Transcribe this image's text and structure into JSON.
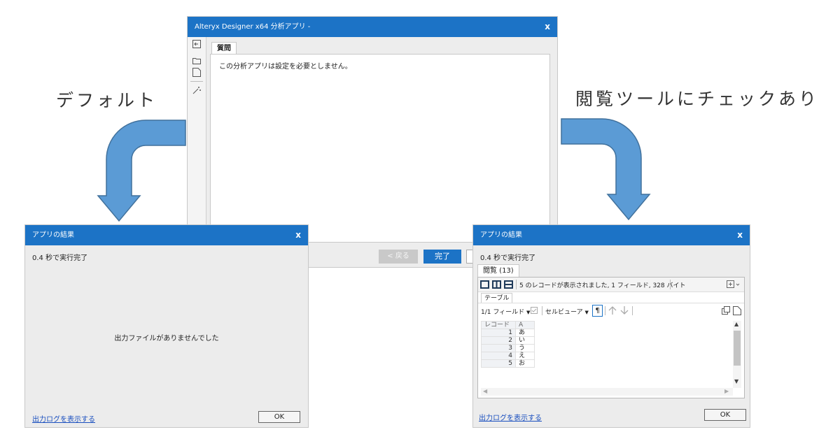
{
  "labels": {
    "left": "デフォルト",
    "right": "閲覧ツールにチェックあり"
  },
  "main_window": {
    "title": "Alteryx Designer x64 分析アプリ -",
    "close": "x",
    "tab": "質問",
    "message": "この分析アプリは設定を必要としません。",
    "back_button": "< 戻る",
    "finish_button": "完了"
  },
  "left_dialog": {
    "title": "アプリの結果",
    "close": "x",
    "status": "0.4 秒で実行完了",
    "empty_message": "出力ファイルがありませんでした",
    "log_link": "出力ログを表示する",
    "ok": "OK"
  },
  "right_dialog": {
    "title": "アプリの結果",
    "close": "x",
    "status": "0.4 秒で実行完了",
    "tab": "閲覧 (13)",
    "record_info": "5 のレコードが表示されました, 1 フィールド, 328 バイト",
    "subtab": "テーブル",
    "field_selector": "1/1 フィールド",
    "cell_viewer": "セルビューア",
    "pilcrow": "¶",
    "columns": [
      "レコード",
      "A"
    ],
    "rows": [
      {
        "n": "1",
        "a": "あ"
      },
      {
        "n": "2",
        "a": "い"
      },
      {
        "n": "3",
        "a": "う"
      },
      {
        "n": "4",
        "a": "え"
      },
      {
        "n": "5",
        "a": "お"
      }
    ],
    "log_link": "出力ログを表示する",
    "ok": "OK"
  },
  "colors": {
    "titlebar": "#1c73c6",
    "arrow": "#5b9bd5",
    "arrow_border": "#41719c",
    "primary_button": "#1c73c6"
  }
}
